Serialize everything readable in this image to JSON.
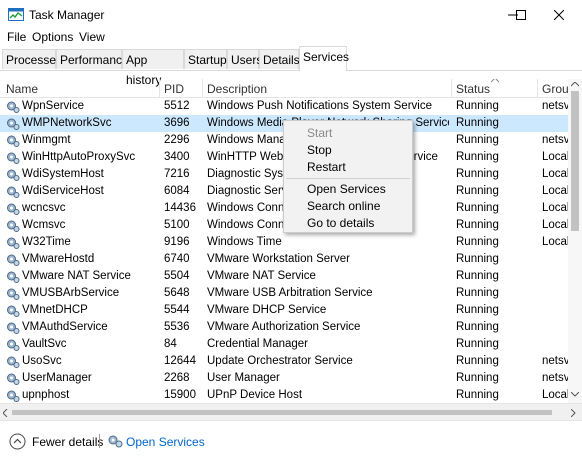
{
  "window": {
    "title": "Task Manager"
  },
  "menu": [
    "File",
    "Options",
    "View"
  ],
  "tabs": [
    "Processes",
    "Performance",
    "App history",
    "Startup",
    "Users",
    "Details",
    "Services"
  ],
  "columns": {
    "name": "Name",
    "pid": "PID",
    "description": "Description",
    "status": "Status",
    "group": "Group"
  },
  "rows": [
    {
      "name": "WpnService",
      "pid": "5512",
      "description": "Windows Push Notifications System Service",
      "status": "Running",
      "group": "netsvc"
    },
    {
      "name": "WMPNetworkSvc",
      "pid": "3696",
      "description": "Windows Media Player Network Sharing Service",
      "status": "Running",
      "group": ""
    },
    {
      "name": "Winmgmt",
      "pid": "2296",
      "description": "Windows Management Instrumentation",
      "status": "Running",
      "group": "netsvc"
    },
    {
      "name": "WinHttpAutoProxySvc",
      "pid": "3400",
      "description": "WinHTTP Web Proxy Auto-Discovery Service",
      "status": "Running",
      "group": "LocalS"
    },
    {
      "name": "WdiSystemHost",
      "pid": "7216",
      "description": "Diagnostic System Host",
      "status": "Running",
      "group": "LocalS"
    },
    {
      "name": "WdiServiceHost",
      "pid": "6084",
      "description": "Diagnostic Service Host",
      "status": "Running",
      "group": "LocalS"
    },
    {
      "name": "wcncsvc",
      "pid": "14436",
      "description": "Windows Connect Now",
      "status": "Running",
      "group": "LocalS"
    },
    {
      "name": "Wcmsvc",
      "pid": "5100",
      "description": "Windows Connection Manager",
      "status": "Running",
      "group": "LocalS"
    },
    {
      "name": "W32Time",
      "pid": "9196",
      "description": "Windows Time",
      "status": "Running",
      "group": "LocalS"
    },
    {
      "name": "VMwareHostd",
      "pid": "6740",
      "description": "VMware Workstation Server",
      "status": "Running",
      "group": ""
    },
    {
      "name": "VMware NAT Service",
      "pid": "5504",
      "description": "VMware NAT Service",
      "status": "Running",
      "group": ""
    },
    {
      "name": "VMUSBArbService",
      "pid": "5648",
      "description": "VMware USB Arbitration Service",
      "status": "Running",
      "group": ""
    },
    {
      "name": "VMnetDHCP",
      "pid": "5544",
      "description": "VMware DHCP Service",
      "status": "Running",
      "group": ""
    },
    {
      "name": "VMAuthdService",
      "pid": "5536",
      "description": "VMware Authorization Service",
      "status": "Running",
      "group": ""
    },
    {
      "name": "VaultSvc",
      "pid": "84",
      "description": "Credential Manager",
      "status": "Running",
      "group": ""
    },
    {
      "name": "UsoSvc",
      "pid": "12644",
      "description": "Update Orchestrator Service",
      "status": "Running",
      "group": "netsvc"
    },
    {
      "name": "UserManager",
      "pid": "2268",
      "description": "User Manager",
      "status": "Running",
      "group": "netsvc"
    },
    {
      "name": "upnphost",
      "pid": "15900",
      "description": "UPnP Device Host",
      "status": "Running",
      "group": "LocalS"
    }
  ],
  "context_menu": [
    "Start",
    "Stop",
    "Restart",
    "Open Services",
    "Search online",
    "Go to details"
  ],
  "footer": {
    "fewer_details": "Fewer details",
    "open_services": "Open Services"
  },
  "colors": {
    "selection": "#cce8ff",
    "link": "#0066cc"
  }
}
